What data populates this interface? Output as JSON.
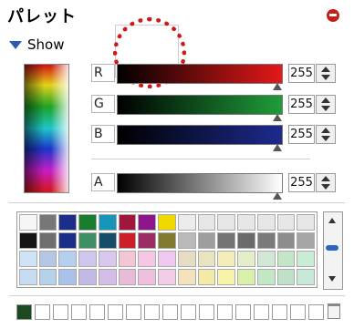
{
  "panel": {
    "title": "パレット",
    "toggle_label": "Show"
  },
  "preview": {
    "color": "#ffffff"
  },
  "channels": [
    {
      "label": "R",
      "value": "255",
      "gradient_start": "#000000",
      "gradient_end": "#e41818"
    },
    {
      "label": "G",
      "value": "255",
      "gradient_start": "#000000",
      "gradient_end": "#1f9d3a"
    },
    {
      "label": "B",
      "value": "255",
      "gradient_start": "#000000",
      "gradient_end": "#1d2a8f"
    },
    {
      "label": "A",
      "value": "255",
      "gradient_start": "#000000",
      "gradient_end": "#ffffff"
    }
  ],
  "swatches": [
    "#f6f6f6",
    "#777777",
    "#1b2f8a",
    "#177c2e",
    "#1695b8",
    "#a0163c",
    "#8f168a",
    "#f0d800",
    "#ececec",
    "#e6e6e6",
    "#e6e6e6",
    "#e6e6e6",
    "#e6e6e6",
    "#e6e6e6",
    "#e6e6e6",
    "#141414",
    "#6e6e6e",
    "#1b2f8a",
    "#3f8f64",
    "#164e6a",
    "#cc1f2a",
    "#9a2d62",
    "#7f7a2e",
    "#b9b9b9",
    "#9e9e9e",
    "#747474",
    "#6b6b6b",
    "#7a7a7a",
    "#8c8c8c",
    "#a5a5a5",
    "#cfe3f4",
    "#b4c8e6",
    "#b4d0ee",
    "#cfc6ee",
    "#d8c8ee",
    "#f3c6d6",
    "#f5c6e3",
    "#f1c8f0",
    "#e6dcc4",
    "#e8e4bf",
    "#f3eeb8",
    "#e3eec8",
    "#d1e8d6",
    "#c4e6c6",
    "#c9ecd5",
    "#c6dcf3",
    "#b4d2ec",
    "#a8c1e8",
    "#c3b9e6",
    "#d4bde6",
    "#e8bbd9",
    "#eec0dd",
    "#f3cde8",
    "#f4e2bd",
    "#f3eaa8",
    "#f6f4a8",
    "#d9f0a9",
    "#c1e7c5",
    "#bfe1ca",
    "#c6e8d7"
  ],
  "bottom_row": [
    "#1c4a1f",
    "#ffffff",
    "#ffffff",
    "#ffffff",
    "#ffffff",
    "#ffffff",
    "#ffffff",
    "#ffffff",
    "#ffffff",
    "#ffffff",
    "#ffffff",
    "#ffffff",
    "#ffffff",
    "#ffffff",
    "#ffffff",
    "#ffffff",
    "#ffffff"
  ],
  "icons": {
    "close": "close-icon",
    "collapse": "triangle-down-icon",
    "trash": "trash-icon"
  }
}
